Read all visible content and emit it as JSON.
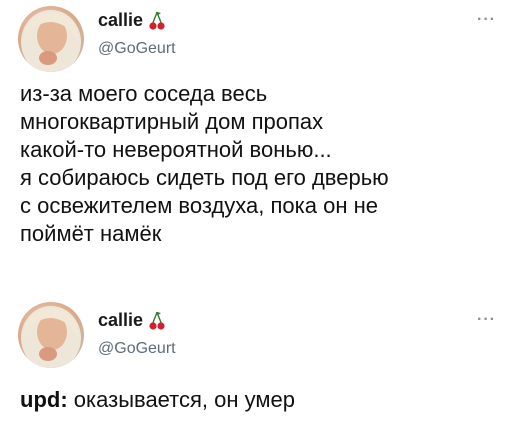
{
  "tweets": [
    {
      "display_name": "callie",
      "handle": "@GoGeurt",
      "text": "из-за моего соседа весь\nмногоквартирный дом пропах\nкакой-то невероятной вонью...\nя собираюсь сидеть под его дверью\nс освежителем воздуха, пока он не\nпоймёт намёк"
    },
    {
      "display_name": "callie",
      "handle": "@GoGeurt",
      "text_prefix": "upd:",
      "text": " оказывается, он умер"
    }
  ],
  "icons": {
    "name_badge": "cherry-icon",
    "menu": "more-options-icon"
  },
  "more_glyph": "···",
  "colors": {
    "handle": "#5f6b75",
    "text": "#111111",
    "cherry_red": "#d1202f",
    "cherry_stem": "#2f7a2a"
  }
}
